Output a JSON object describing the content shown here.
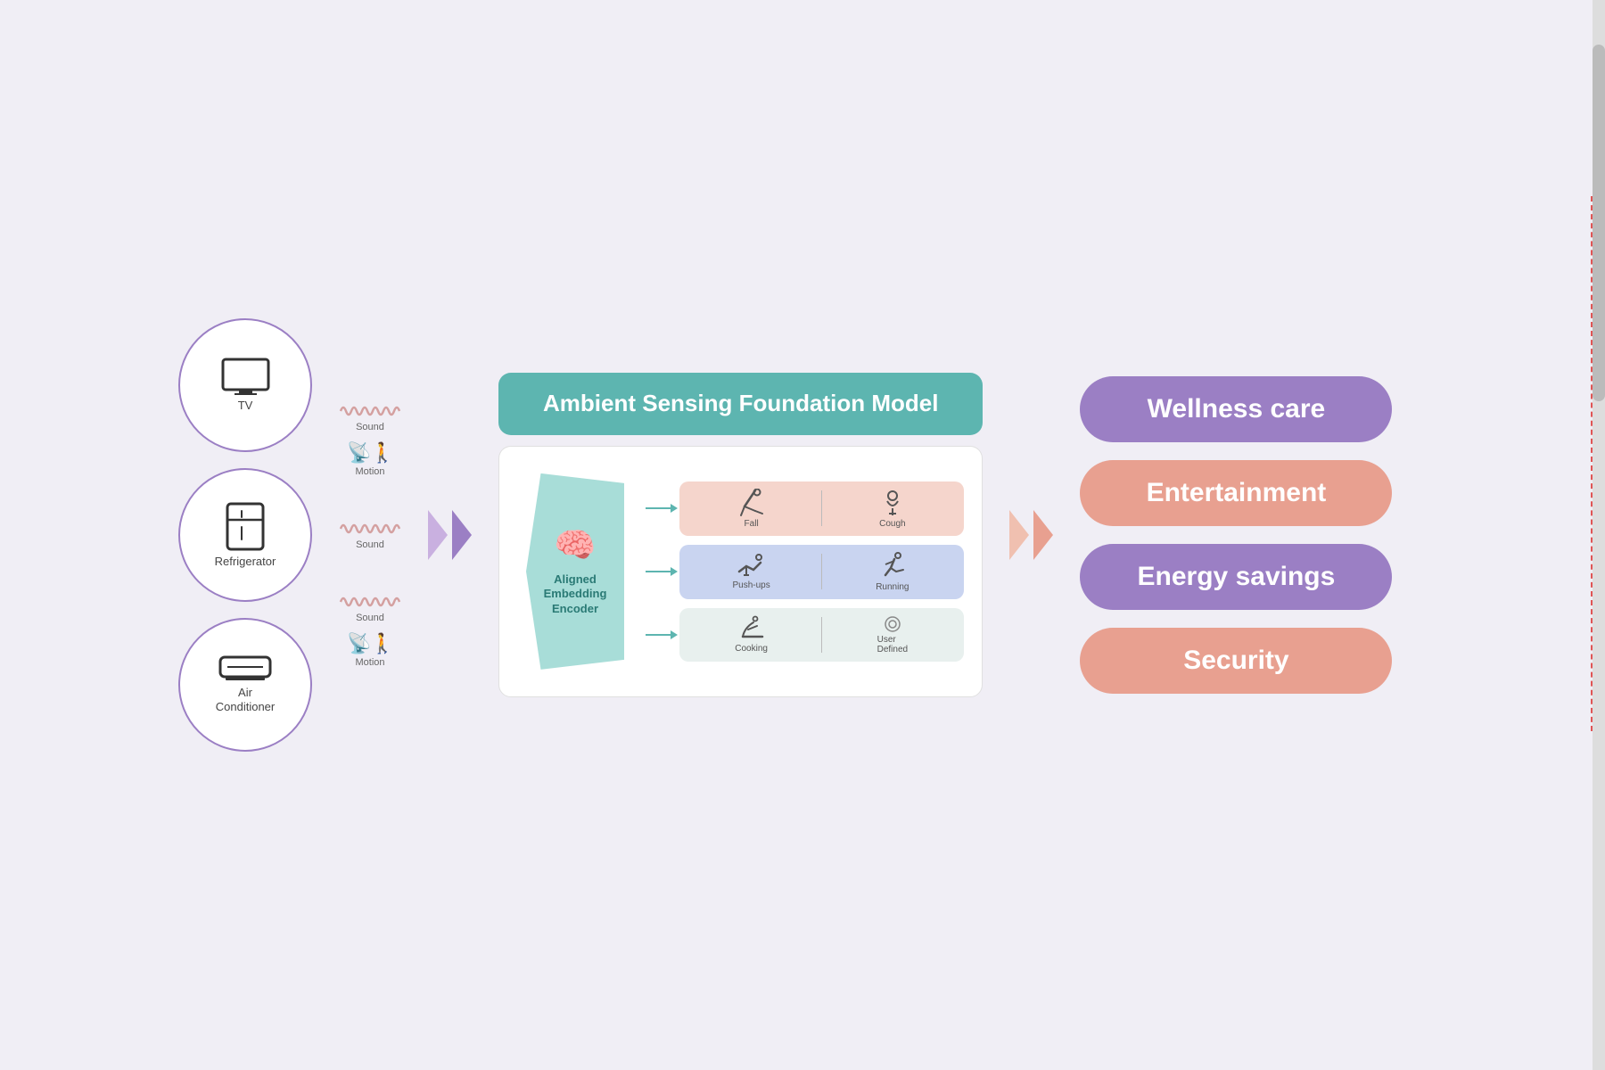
{
  "devices": [
    {
      "id": "tv",
      "icon": "🖥",
      "label": "TV"
    },
    {
      "id": "refrigerator",
      "icon": "🗄",
      "label": "Refrigerator"
    },
    {
      "id": "air-conditioner",
      "icon": "📺",
      "label": "Air\nConditioner"
    }
  ],
  "sensorGroups": [
    {
      "sound": true,
      "motion": true
    },
    {
      "sound": true,
      "motion": false
    },
    {
      "sound": true,
      "motion": true
    }
  ],
  "foundationModel": {
    "title": "Ambient Sensing\nFoundation Model",
    "encoder": {
      "label": "Aligned\nEmbedding\nEncoder"
    },
    "outputs": [
      {
        "type": "pink",
        "items": [
          {
            "icon": "🤸",
            "label": "Fall"
          },
          {
            "icon": "😷",
            "label": "Cough"
          }
        ]
      },
      {
        "type": "purple",
        "items": [
          {
            "icon": "🏋",
            "label": "Push-ups"
          },
          {
            "icon": "🏃",
            "label": "Running"
          }
        ]
      },
      {
        "type": "mint",
        "items": [
          {
            "icon": "👨‍🍳",
            "label": "Cooking"
          },
          {
            "icon": "⊙",
            "label": "User\nDefined"
          }
        ]
      }
    ]
  },
  "resultPills": [
    {
      "id": "wellness",
      "label": "Wellness care",
      "type": "purple"
    },
    {
      "id": "entertainment",
      "label": "Entertainment",
      "type": "pink"
    },
    {
      "id": "energy",
      "label": "Energy savings",
      "type": "purple"
    },
    {
      "id": "security",
      "label": "Security",
      "type": "pink"
    }
  ]
}
